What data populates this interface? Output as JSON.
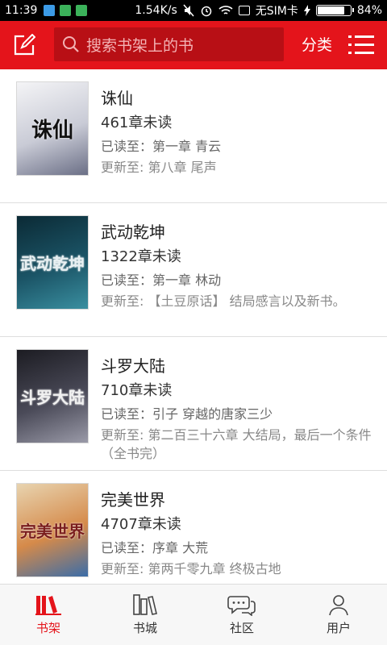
{
  "status_bar": {
    "time": "11:39",
    "speed": "1.54K/s",
    "sim": "无SIM卡",
    "battery": "84%",
    "battery_level": 0.84
  },
  "app_bar": {
    "search_placeholder": "搜索书架上的书",
    "category_label": "分类"
  },
  "books": [
    {
      "title": "诛仙",
      "unread": "461章未读",
      "read_to": "已读至：第一章 青云",
      "update": "更新至: 第八章 尾声",
      "cover_text": "诛仙",
      "cover_colors": [
        "#f4f4f6",
        "#c9cbd6",
        "#6b6f86"
      ]
    },
    {
      "title": "武动乾坤",
      "unread": "1322章未读",
      "read_to": "已读至：第一章 林动",
      "update": "更新至: 【土豆原话】 结局感言以及新书。",
      "cover_text": "武动乾坤",
      "cover_colors": [
        "#0b2a35",
        "#1b5466",
        "#3a8fa0"
      ]
    },
    {
      "title": "斗罗大陆",
      "unread": "710章未读",
      "read_to": "已读至：引子 穿越的唐家三少",
      "update": "更新至: 第二百三十六章 大结局，最后一个条件（全书完）",
      "cover_text": "斗罗大陆",
      "cover_colors": [
        "#1c1c22",
        "#4a4a58",
        "#9a9aa8"
      ]
    },
    {
      "title": "完美世界",
      "unread": "4707章未读",
      "read_to": "已读至：序章 大荒",
      "update": "更新至: 第两千零九章 终极古地",
      "cover_text": "完美世界",
      "cover_colors": [
        "#e8d4b0",
        "#d58a4a",
        "#3b6da8"
      ]
    }
  ],
  "tabs": [
    {
      "label": "书架",
      "active": true
    },
    {
      "label": "书城",
      "active": false
    },
    {
      "label": "社区",
      "active": false
    },
    {
      "label": "用户",
      "active": false
    }
  ],
  "colors": {
    "accent": "#e4141b",
    "search_bg": "#b80f15"
  }
}
